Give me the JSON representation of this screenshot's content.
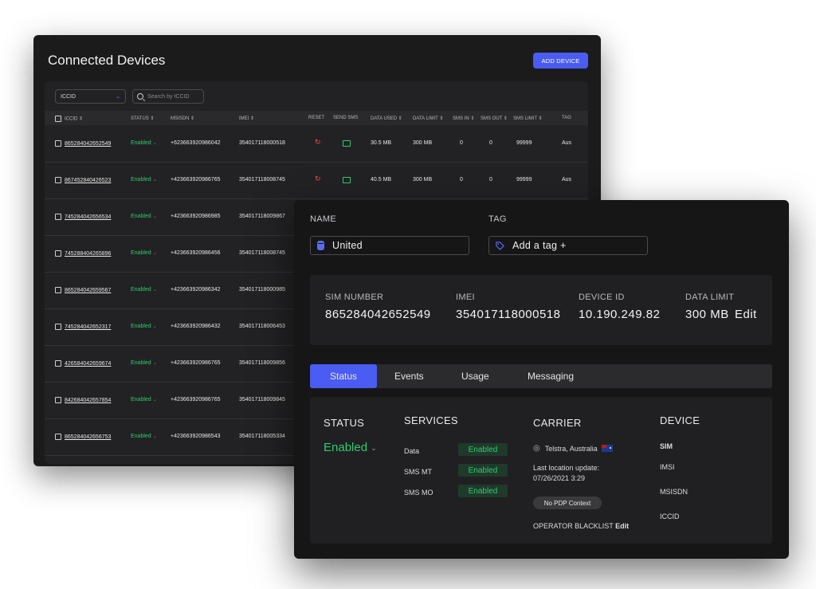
{
  "devices_window": {
    "title": "Connected Devices",
    "add_button": "ADD DEVICE",
    "filter_select": "ICCID",
    "search_placeholder": "Search by ICCID",
    "columns": [
      "ICCID",
      "STATUS",
      "MSISDN",
      "IMEI",
      "RESET",
      "SEND SMS",
      "DATA USED",
      "DATA LIMIT",
      "SMS IN",
      "SMS OUT",
      "SMS LIMIT",
      "TAG"
    ],
    "rows": [
      {
        "iccid": "865284042652549",
        "status": "Enabled",
        "msisdn": "+623663920986042",
        "imei": "354017118000518",
        "data_used": "30.5 MB",
        "data_limit": "300 MB",
        "sms_in": "0",
        "sms_out": "0",
        "sms_limit": "99999",
        "tag": "Aus"
      },
      {
        "iccid": "867452840426523",
        "status": "Enabled",
        "msisdn": "+423663920986765",
        "imei": "354017118008745",
        "data_used": "40.5 MB",
        "data_limit": "300 MB",
        "sms_in": "0",
        "sms_out": "0",
        "sms_limit": "99999",
        "tag": "Aus"
      },
      {
        "iccid": "745284042656534",
        "status": "Enabled",
        "msisdn": "+423663920986985",
        "imei": "354017118009867"
      },
      {
        "iccid": "745288404265896",
        "status": "Enabled",
        "msisdn": "+423663920986456",
        "imei": "354017118008745"
      },
      {
        "iccid": "865284042659567",
        "status": "Enabled",
        "msisdn": "+423663920986342",
        "imei": "354017118000985"
      },
      {
        "iccid": "745284042652317",
        "status": "Enabled",
        "msisdn": "+423663920986432",
        "imei": "354017118006453"
      },
      {
        "iccid": "426584042659674",
        "status": "Enabled",
        "msisdn": "+423663920986765",
        "imei": "354017118009856"
      },
      {
        "iccid": "842684042657854",
        "status": "Enabled",
        "msisdn": "+423663920986765",
        "imei": "354017118009845"
      },
      {
        "iccid": "865284042656753",
        "status": "Enabled",
        "msisdn": "+423663920986543",
        "imei": "354017118005334"
      }
    ]
  },
  "detail_window": {
    "name_label": "NAME",
    "name_value": "United",
    "tag_label": "TAG",
    "tag_placeholder": "Add a tag +",
    "info": {
      "sim_label": "SIM NUMBER",
      "sim_value": "865284042652549",
      "imei_label": "IMEI",
      "imei_value": "354017118000518",
      "device_id_label": "DEVICE ID",
      "device_id_value": "10.190.249.82",
      "data_limit_label": "DATA LIMIT",
      "data_limit_value": "300 MB",
      "edit": "Edit"
    },
    "tabs": [
      "Status",
      "Events",
      "Usage",
      "Messaging"
    ],
    "status_heading": "STATUS",
    "status_value": "Enabled",
    "services_heading": "SERVICES",
    "services": [
      {
        "name": "Data",
        "state": "Enabled"
      },
      {
        "name": "SMS MT",
        "state": "Enabled"
      },
      {
        "name": "SMS MO",
        "state": "Enabled"
      }
    ],
    "carrier_heading": "CARRIER",
    "carrier_name": "Telstra, Australia",
    "last_location_label": "Last location update:",
    "last_location_value": "07/26/2021   3:29",
    "pdp_badge": "No PDP Context",
    "blacklist_label": "OPERATOR BLACKLIST",
    "blacklist_edit": "Edit",
    "device_heading": "DEVICE",
    "device_items": [
      "SIM",
      "IMSI",
      "MSISDN",
      "ICCID"
    ]
  },
  "colors": {
    "accent": "#4a5cf2",
    "enabled": "#2ecc71",
    "reset": "#ff4b4b"
  }
}
